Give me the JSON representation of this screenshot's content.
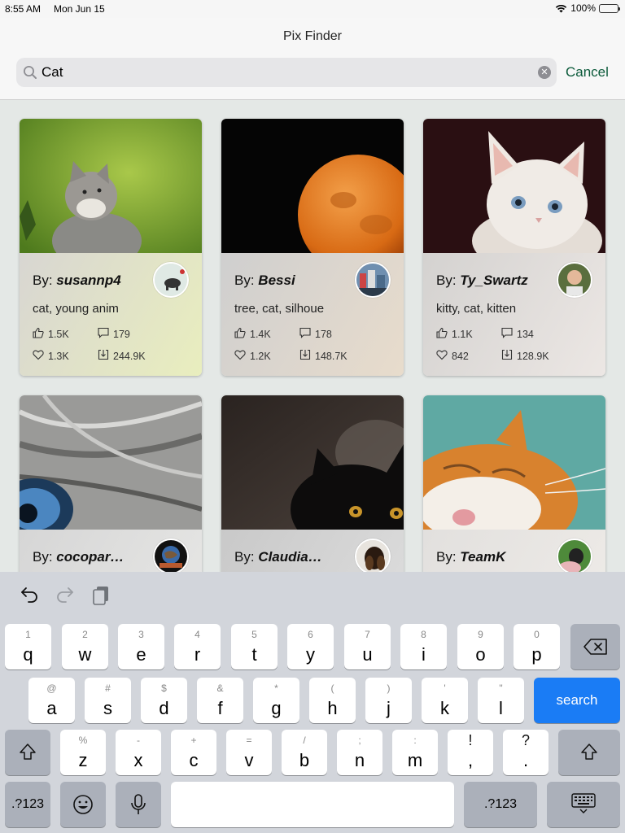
{
  "status_bar": {
    "time": "8:55 AM",
    "date": "Mon Jun 15",
    "battery": "100%"
  },
  "nav": {
    "title": "Pix Finder",
    "cancel_label": "Cancel"
  },
  "search": {
    "value": "Cat",
    "placeholder": ""
  },
  "cards": [
    {
      "by": "By: ",
      "user": "susannp4",
      "tags": "cat, young anim",
      "likes": "1.5K",
      "comments": "179",
      "favorites": "1.3K",
      "downloads": "244.9K"
    },
    {
      "by": "By: ",
      "user": "Bessi",
      "tags": "tree, cat, silhoue",
      "likes": "1.4K",
      "comments": "178",
      "favorites": "1.2K",
      "downloads": "148.7K"
    },
    {
      "by": "By: ",
      "user": "Ty_Swartz",
      "tags": "kitty, cat, kitten",
      "likes": "1.1K",
      "comments": "134",
      "favorites": "842",
      "downloads": "128.9K"
    },
    {
      "by": "By: ",
      "user": "cocopar…"
    },
    {
      "by": "By: ",
      "user": "Claudia…"
    },
    {
      "by": "By: ",
      "user": "TeamK"
    }
  ],
  "keyboard": {
    "row1": [
      {
        "hint": "1",
        "key": "q"
      },
      {
        "hint": "2",
        "key": "w"
      },
      {
        "hint": "3",
        "key": "e"
      },
      {
        "hint": "4",
        "key": "r"
      },
      {
        "hint": "5",
        "key": "t"
      },
      {
        "hint": "6",
        "key": "y"
      },
      {
        "hint": "7",
        "key": "u"
      },
      {
        "hint": "8",
        "key": "i"
      },
      {
        "hint": "9",
        "key": "o"
      },
      {
        "hint": "0",
        "key": "p"
      }
    ],
    "row2": [
      {
        "hint": "@",
        "key": "a"
      },
      {
        "hint": "#",
        "key": "s"
      },
      {
        "hint": "$",
        "key": "d"
      },
      {
        "hint": "&",
        "key": "f"
      },
      {
        "hint": "*",
        "key": "g"
      },
      {
        "hint": "(",
        "key": "h"
      },
      {
        "hint": ")",
        "key": "j"
      },
      {
        "hint": "'",
        "key": "k"
      },
      {
        "hint": "\"",
        "key": "l"
      }
    ],
    "row3": [
      {
        "hint": "%",
        "key": "z"
      },
      {
        "hint": "-",
        "key": "x"
      },
      {
        "hint": "+",
        "key": "c"
      },
      {
        "hint": "=",
        "key": "v"
      },
      {
        "hint": "/",
        "key": "b"
      },
      {
        "hint": ";",
        "key": "n"
      },
      {
        "hint": ":",
        "key": "m"
      },
      {
        "hint": "!",
        "key": ","
      },
      {
        "hint": "?",
        "key": "."
      }
    ],
    "search_label": "search",
    "numbers_label": ".?123"
  },
  "colors": {
    "accent": "#1a7cf5",
    "cancel": "#0b5a3a"
  }
}
